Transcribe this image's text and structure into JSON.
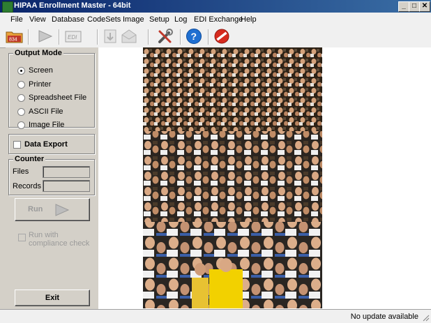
{
  "window": {
    "title": "HIPAA Enrollment Master - 64bit"
  },
  "menu": [
    "File",
    "View",
    "Database",
    "CodeSets",
    "Image",
    "Setup",
    "Log",
    "EDI Exchange",
    "Help"
  ],
  "toolbar": {
    "open_834_label": "834",
    "edi_label": "EDI"
  },
  "output_mode": {
    "title": "Output Mode",
    "options": [
      "Screen",
      "Printer",
      "Spreadsheet File",
      "ASCII File",
      "Image File"
    ],
    "selected": "Screen"
  },
  "data_export": {
    "label": "Data Export",
    "checked": false
  },
  "counter": {
    "title": "Counter",
    "files_label": "Files",
    "records_label": "Records",
    "files_value": "",
    "records_value": ""
  },
  "run": {
    "label": "Run",
    "compliance_label_1": "Run with",
    "compliance_label_2": "compliance check"
  },
  "exit": {
    "label": "Exit"
  },
  "status": {
    "text": "No update available"
  },
  "colors": {
    "title_start": "#0a246a",
    "title_end": "#3a6ea5",
    "help_blue": "#1f6fd1",
    "stop_red": "#d62a1e",
    "shirt_yellow": "#f2d100"
  }
}
